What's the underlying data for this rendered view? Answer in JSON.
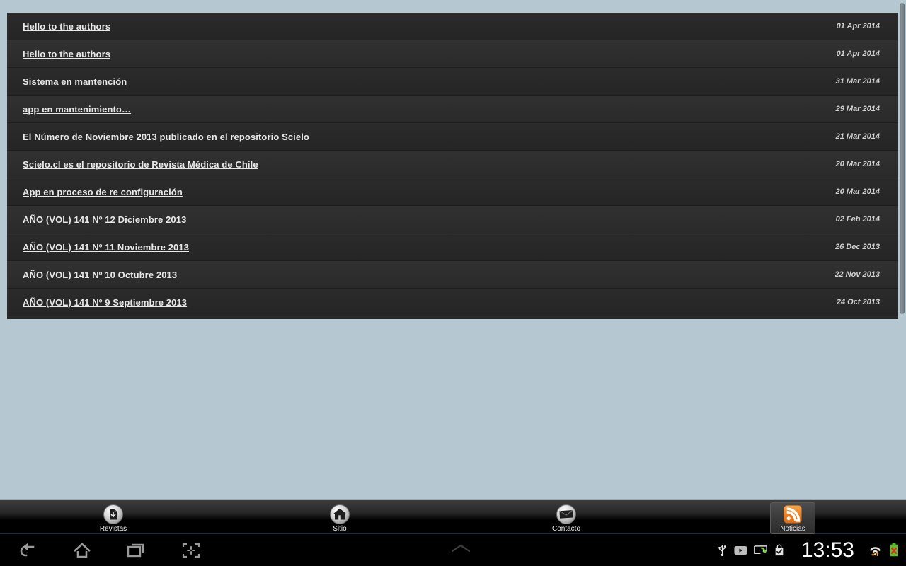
{
  "app": {
    "background_color": "#b5c8d1",
    "list_background": "#2a2a2a"
  },
  "news": {
    "items": [
      {
        "title": "Hello to the authors",
        "date": "01 Apr 2014"
      },
      {
        "title": "Hello to the authors",
        "date": "01 Apr 2014"
      },
      {
        "title": "Sistema en mantención",
        "date": "31 Mar 2014"
      },
      {
        "title": "app en mantenimiento…",
        "date": "29 Mar 2014"
      },
      {
        "title": "El Número de Noviembre 2013 publicado en el repositorio Scielo",
        "date": "21 Mar 2014"
      },
      {
        "title": "Scielo.cl es el repositorio de Revista Médica de Chile",
        "date": "20 Mar 2014"
      },
      {
        "title": "App en proceso de re configuración",
        "date": "20 Mar 2014"
      },
      {
        "title": "AÑO (VOL) 141 Nº 12 Diciembre 2013",
        "date": "02 Feb 2014"
      },
      {
        "title": "AÑO (VOL) 141 Nº 11 Noviembre 2013",
        "date": "26 Dec 2013"
      },
      {
        "title": "AÑO (VOL) 141 Nº 10 Octubre 2013",
        "date": "22 Nov 2013"
      },
      {
        "title": "AÑO (VOL) 141 Nº 9 Septiembre 2013",
        "date": "24 Oct 2013"
      }
    ]
  },
  "tabbar": {
    "active_index": 3,
    "active_color": "#f08020",
    "tabs": [
      {
        "label": "Revistas",
        "icon": "document-download-icon"
      },
      {
        "label": "Sitio",
        "icon": "home-icon"
      },
      {
        "label": "Contacto",
        "icon": "envelope-icon"
      },
      {
        "label": "Noticias",
        "icon": "rss-icon"
      }
    ]
  },
  "system_bar": {
    "nav": [
      {
        "name": "back",
        "icon": "back-arrow-icon"
      },
      {
        "name": "home",
        "icon": "home-outline-icon"
      },
      {
        "name": "recents",
        "icon": "recent-apps-icon"
      },
      {
        "name": "screenshot",
        "icon": "screenshot-capture-icon"
      }
    ],
    "menu_handle_icon": "chevron-up-icon",
    "status": {
      "clock": "13:53",
      "icons": [
        {
          "name": "usb-icon"
        },
        {
          "name": "youtube-icon"
        },
        {
          "name": "screencast-icon"
        },
        {
          "name": "play-store-check-icon"
        },
        {
          "name": "wifi-icon"
        },
        {
          "name": "battery-error-icon"
        }
      ]
    }
  }
}
